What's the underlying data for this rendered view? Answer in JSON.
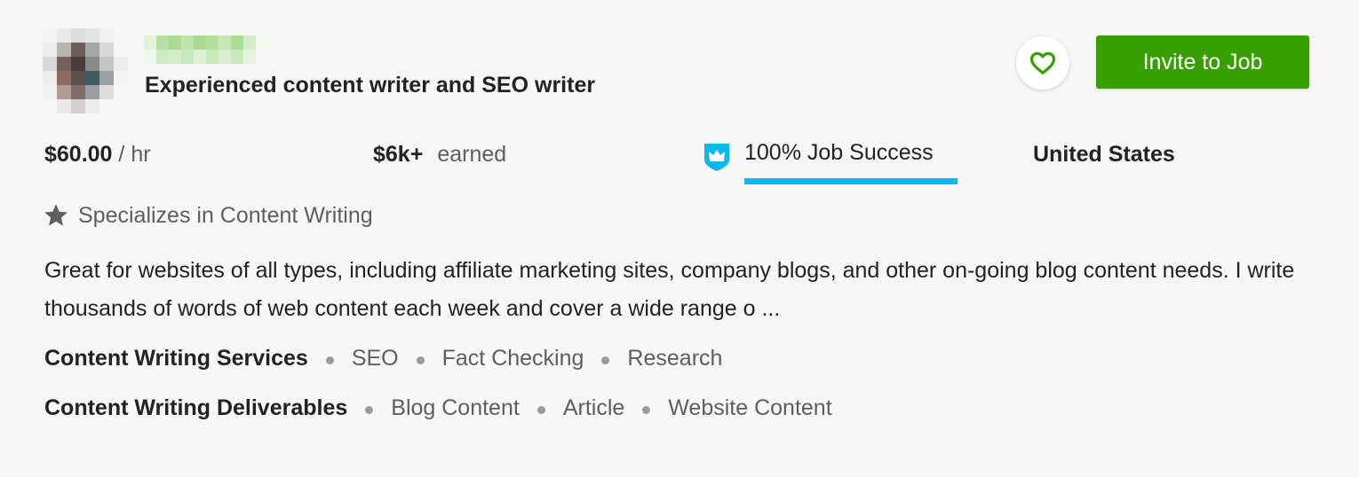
{
  "profile": {
    "title": "Experienced content writer and SEO writer",
    "rate": {
      "amount": "$60.00",
      "unit": "/ hr"
    },
    "earned": {
      "amount": "$6k+",
      "label": "earned"
    },
    "job_success": {
      "text": "100% Job Success",
      "value_percent": 100,
      "badge_icon": "crown-shield-icon",
      "bar_color": "#0fb6ec"
    },
    "location": "United States",
    "specializes": {
      "icon": "star-icon",
      "text": "Specializes in Content Writing"
    },
    "description": "Great for websites of all types, including affiliate marketing sites, company blogs, and other on-going blog content needs. I write thousands of words of web content each week and cover a wide range o ...",
    "skill_groups": [
      {
        "label": "Content Writing Services",
        "skills": [
          "SEO",
          "Fact Checking",
          "Research"
        ]
      },
      {
        "label": "Content Writing Deliverables",
        "skills": [
          "Blog Content",
          "Article",
          "Website Content"
        ]
      }
    ]
  },
  "actions": {
    "save_icon": "heart-icon",
    "invite_label": "Invite to Job",
    "accent_color": "#37a000"
  }
}
